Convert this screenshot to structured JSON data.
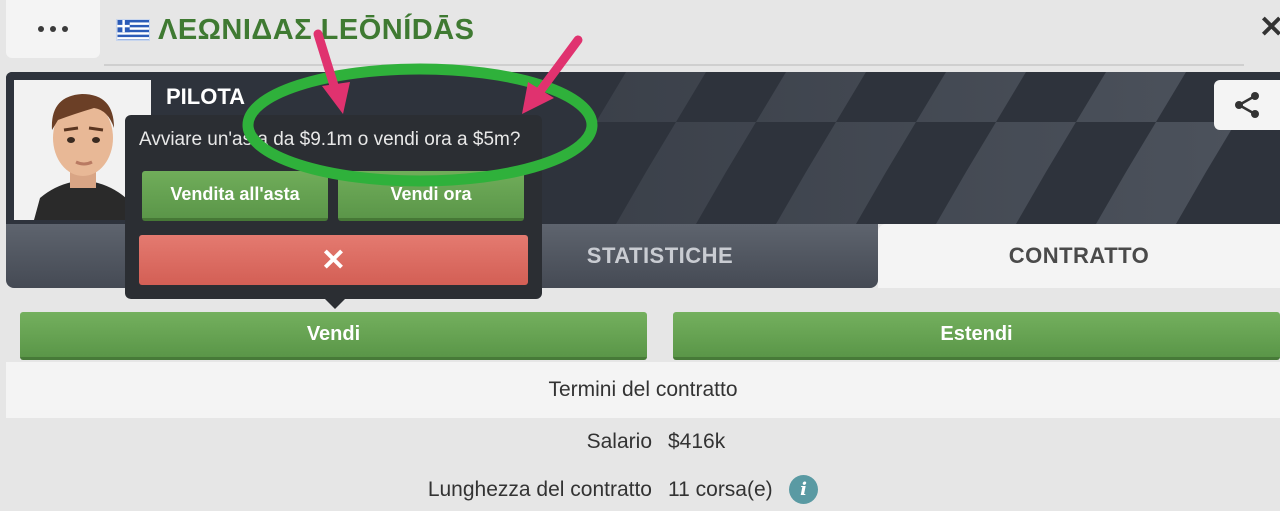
{
  "header": {
    "menu_icon": "more-horizontal-icon",
    "title": "ΛΕΩΝΙΔΑΣ LEŌNÍDĀS",
    "flag": "greece-flag",
    "close_icon": "close-icon"
  },
  "profile": {
    "role": "PILOTA",
    "share_icon": "share-icon"
  },
  "tabs": [
    {
      "label": ""
    },
    {
      "label": "STATISTICHE"
    },
    {
      "label": "CONTRATTO",
      "active": true
    }
  ],
  "actions": {
    "sell_label": "Vendi",
    "extend_label": "Estendi"
  },
  "popup": {
    "message": "Avviare un'asta da $9.1m o vendi ora a $5m?",
    "auction_label": "Vendita all'asta",
    "sell_now_label": "Vendi ora",
    "cancel_symbol": "✕"
  },
  "contract": {
    "heading": "Termini del contratto",
    "rows": [
      {
        "label": "Salario",
        "value": "$416k"
      },
      {
        "label": "Lunghezza del contratto",
        "value": "11 corsa(e)"
      }
    ]
  },
  "colors": {
    "green_button": "#6aa553",
    "red_button": "#dc6b61",
    "title_green": "#3f7a32",
    "annotation_green": "#2fb13b",
    "annotation_pink": "#e0326f"
  }
}
